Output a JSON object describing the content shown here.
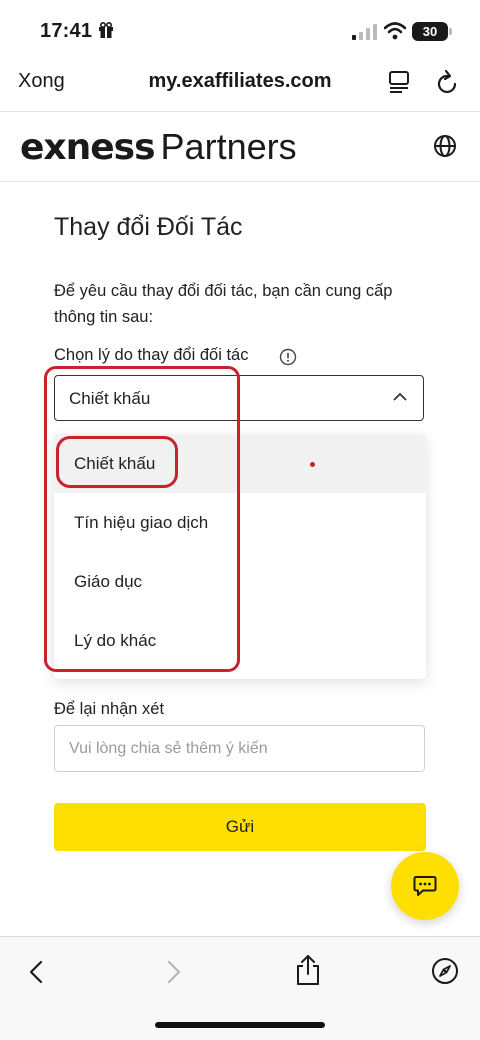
{
  "status_bar": {
    "time": "17:41",
    "battery": "30"
  },
  "browser": {
    "done_label": "Xong",
    "url": "my.exaffiliates.com"
  },
  "site": {
    "logo_brand": "exness",
    "logo_suffix": "Partners"
  },
  "form": {
    "title": "Thay đổi Đối Tác",
    "description": "Để yêu cầu thay đổi đối tác, bạn cần cung cấp thông tin sau:",
    "reason_label": "Chọn lý do thay đổi đối tác",
    "selected_reason": "Chiết khấu",
    "options": [
      "Chiết khấu",
      "Tín hiệu giao dịch",
      "Giáo dục",
      "Lý do khác"
    ],
    "comment_label": "Để lại nhận xét",
    "comment_placeholder": "Vui lòng chia sẻ thêm ý kiến",
    "comment_value": "",
    "submit_label": "Gửi"
  },
  "colors": {
    "accent": "#ffde02",
    "annotation": "#c8222d"
  },
  "icons": [
    "gift-icon",
    "signal-icon",
    "wifi-icon",
    "battery-icon",
    "reader-icon",
    "reload-icon",
    "globe-icon",
    "info-icon",
    "chevron-up-icon",
    "chat-icon",
    "back-icon",
    "forward-icon",
    "share-icon",
    "compass-icon"
  ]
}
